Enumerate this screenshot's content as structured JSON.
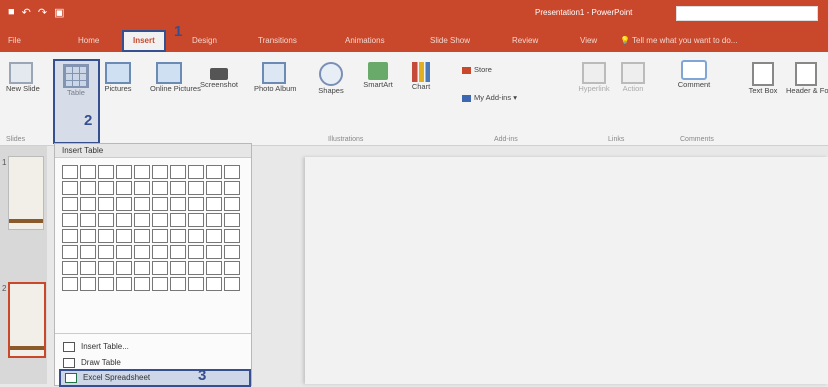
{
  "window": {
    "title": "Presentation1 - PowerPoint"
  },
  "qat": {
    "save_icon": "save-icon",
    "undo_icon": "undo-icon",
    "redo_icon": "redo-icon",
    "present_icon": "present-icon"
  },
  "tabs": [
    "File",
    "Home",
    "Insert",
    "Design",
    "Transitions",
    "Animations",
    "Slide Show",
    "Review",
    "View"
  ],
  "tell_me": "Tell me what you want to do...",
  "ribbon": {
    "new_slide": "New Slide",
    "table": "Table",
    "pictures": "Pictures",
    "online_pictures": "Online Pictures",
    "screenshot": "Screenshot",
    "photo_album": "Photo Album",
    "shapes": "Shapes",
    "smartart": "SmartArt",
    "chart": "Chart",
    "store": "Store",
    "my_addins": "My Add-ins",
    "hyperlink": "Hyperlink",
    "action": "Action",
    "comment": "Comment",
    "text_box": "Text Box",
    "header_footer": "Header & Footer",
    "groups": {
      "slides": "Slides",
      "illustrations": "Illustrations",
      "addins": "Add-ins",
      "links": "Links",
      "comments": "Comments"
    }
  },
  "dropdown": {
    "header": "Insert Table",
    "grid_cols": 10,
    "grid_rows": 8,
    "items": [
      "Insert Table...",
      "Draw Table",
      "Excel Spreadsheet"
    ]
  },
  "slides": {
    "nums": [
      "1",
      "2"
    ]
  },
  "badges": [
    "1",
    "2",
    "3"
  ],
  "colors": {
    "accent": "#c9472b",
    "highlight": "#36508f"
  }
}
